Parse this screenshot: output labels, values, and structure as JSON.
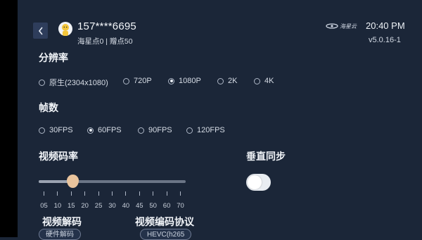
{
  "header": {
    "back_icon": "chevron-left-icon",
    "user_name": "157****6695",
    "user_points": "海星点0 | 赠点50",
    "brand_logo_text": "海星云",
    "time": "20:40 PM",
    "version": "v5.0.16-1"
  },
  "resolution": {
    "title": "分辨率",
    "options": [
      "原生(2304x1080)",
      "720P",
      "1080P",
      "2K",
      "4K"
    ],
    "selected": "1080P"
  },
  "fps": {
    "title": "帧数",
    "options": [
      "30FPS",
      "60FPS",
      "90FPS",
      "120FPS"
    ],
    "selected": "60FPS"
  },
  "bitrate": {
    "title": "视频码率",
    "ticks": [
      "05",
      "10",
      "15",
      "20",
      "25",
      "30",
      "40",
      "45",
      "50",
      "60",
      "70"
    ],
    "value": "10"
  },
  "vsync": {
    "title": "垂直同步",
    "enabled": true
  },
  "video_decode": {
    "title": "视频解码",
    "value": "硬件解码"
  },
  "video_encode": {
    "title": "视频编码协议",
    "value": "HEVC(h265"
  },
  "colors": {
    "background": "#1b2638",
    "accent_thumb": "#e9c49d"
  }
}
